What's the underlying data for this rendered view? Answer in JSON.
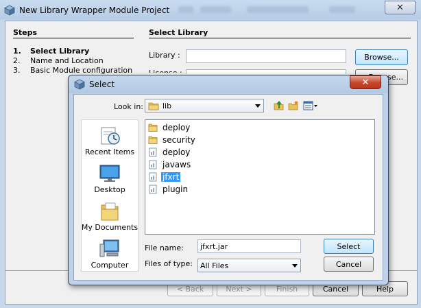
{
  "wizard": {
    "title": "New Library Wrapper Module Project",
    "steps_title": "Steps",
    "steps": [
      {
        "num": "1.",
        "label": "Select Library"
      },
      {
        "num": "2.",
        "label": "Name and Location"
      },
      {
        "num": "3.",
        "label": "Basic Module configuration"
      }
    ],
    "section_title": "Select Library",
    "library_label": "Library :",
    "license_label": "License :",
    "browse_label": "Browse...",
    "browse2_label": "Browse...",
    "buttons": {
      "back": "< Back",
      "next": "Next >",
      "finish": "Finish",
      "cancel": "Cancel",
      "help": "Help"
    }
  },
  "dialog": {
    "title": "Select",
    "look_in_label": "Look in:",
    "look_in_value": "lib",
    "places": [
      {
        "label": "Recent Items",
        "icon": "recent-items-icon"
      },
      {
        "label": "Desktop",
        "icon": "desktop-icon"
      },
      {
        "label": "My Documents",
        "icon": "my-documents-icon"
      },
      {
        "label": "Computer",
        "icon": "computer-icon"
      }
    ],
    "files": [
      {
        "name": "deploy",
        "kind": "folder"
      },
      {
        "name": "security",
        "kind": "folder"
      },
      {
        "name": "deploy",
        "kind": "file"
      },
      {
        "name": "javaws",
        "kind": "file"
      },
      {
        "name": "jfxrt",
        "kind": "file",
        "selected": true
      },
      {
        "name": "plugin",
        "kind": "file"
      }
    ],
    "file_name_label": "File name:",
    "file_name_value": "jfxrt.jar",
    "file_type_label": "Files of type:",
    "file_type_value": "All Files",
    "select_button": "Select",
    "cancel_button": "Cancel"
  }
}
